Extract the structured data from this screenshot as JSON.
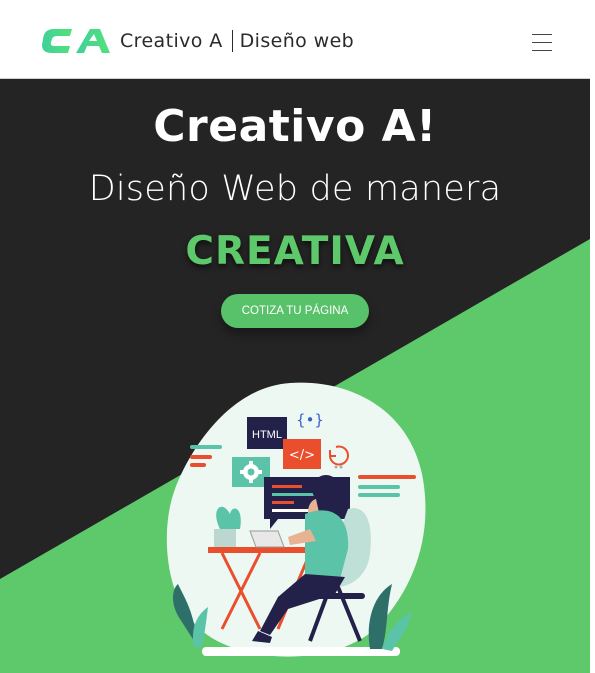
{
  "navbar": {
    "brand_logo_text": "CA",
    "brand_name": "Creativo A",
    "brand_tagline": "Diseño web",
    "menu_icon": "hamburger-menu-icon"
  },
  "hero": {
    "title": "Creativo A!",
    "subtitle": "Diseño Web de manera",
    "highlight": "CREATIVA",
    "cta_label": "COTIZA TU PÁGINA"
  },
  "illustration": {
    "html_tag_text": "HTML",
    "code_icon_text": "</>",
    "braces_icon_text": "{•}"
  },
  "colors": {
    "accent_green": "#5ec96a",
    "hero_dark": "#242424",
    "code_red": "#ea4f2d",
    "panel_navy": "#23214a"
  }
}
